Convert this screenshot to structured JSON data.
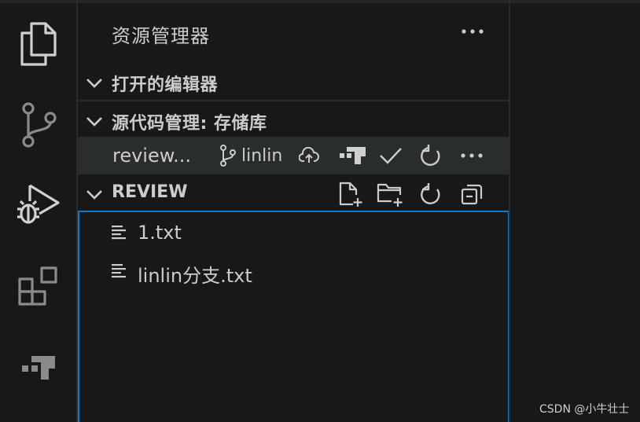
{
  "sidebar": {
    "title": "资源管理器",
    "sections": {
      "open_editors": "打开的编辑器",
      "source_control": "源代码管理: 存储库",
      "review": "REVIEW"
    }
  },
  "repository": {
    "name": "review...",
    "branch": "linlin"
  },
  "files": [
    {
      "name": "1.txt"
    },
    {
      "name": "linlin分支.txt"
    }
  ],
  "watermark": "CSDN @小牛壮士",
  "colors": {
    "background": "#181818",
    "hover_row": "#2a2d2e",
    "focus_border": "#0a79d1",
    "foreground": "#cccccc"
  },
  "icons": {
    "activity": [
      "explorer-icon",
      "source-control-icon",
      "run-debug-icon",
      "extensions-icon",
      "gitlens-icon"
    ],
    "repo_actions": [
      "cloud-upload-icon",
      "gitlens-icon",
      "check-icon",
      "refresh-icon",
      "more-icon"
    ],
    "review_actions": [
      "new-file-icon",
      "new-folder-icon",
      "refresh-icon",
      "collapse-all-icon"
    ]
  }
}
